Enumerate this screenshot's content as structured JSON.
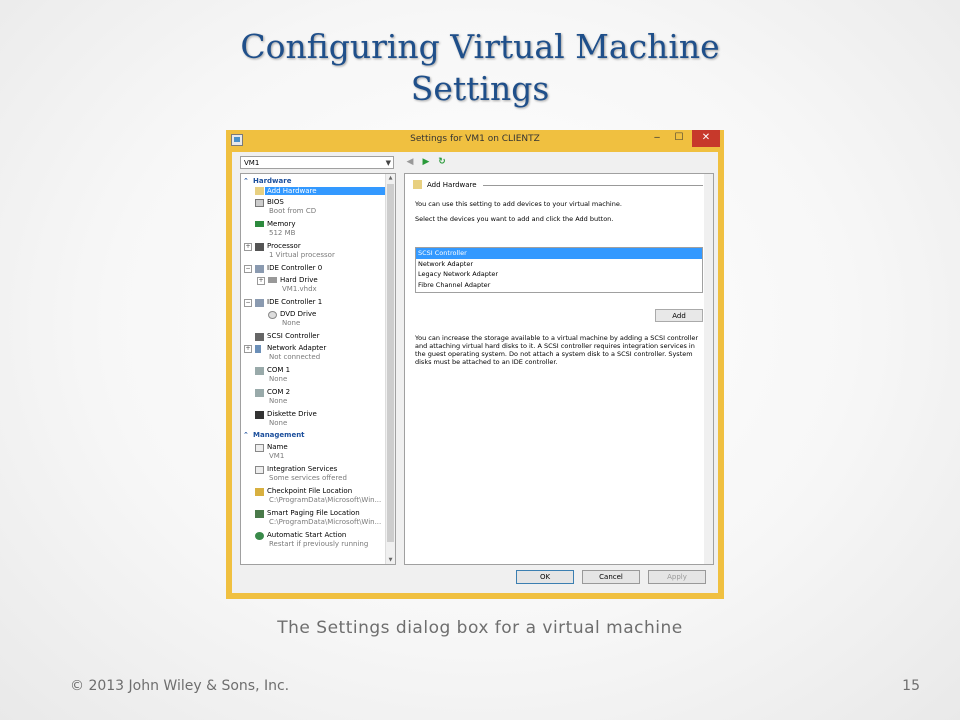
{
  "slide": {
    "title_line1": "Configuring Virtual Machine",
    "title_line2": "Settings",
    "caption": "The Settings dialog box for a virtual machine",
    "copyright": "© 2013 John Wiley & Sons, Inc.",
    "page_number": "15"
  },
  "dialog": {
    "title": "Settings for VM1 on CLIENTZ",
    "vm_selector": "VM1",
    "tree": {
      "hardware_label": "Hardware",
      "management_label": "Management",
      "hardware_items": [
        {
          "label": "Add Hardware",
          "sub": ""
        },
        {
          "label": "BIOS",
          "sub": "Boot from CD"
        },
        {
          "label": "Memory",
          "sub": "512 MB"
        },
        {
          "label": "Processor",
          "sub": "1 Virtual processor"
        },
        {
          "label": "IDE Controller 0",
          "sub": ""
        },
        {
          "label": "Hard Drive",
          "sub": "VM1.vhdx"
        },
        {
          "label": "IDE Controller 1",
          "sub": ""
        },
        {
          "label": "DVD Drive",
          "sub": "None"
        },
        {
          "label": "SCSI Controller",
          "sub": ""
        },
        {
          "label": "Network Adapter",
          "sub": "Not connected"
        },
        {
          "label": "COM 1",
          "sub": "None"
        },
        {
          "label": "COM 2",
          "sub": "None"
        },
        {
          "label": "Diskette Drive",
          "sub": "None"
        }
      ],
      "management_items": [
        {
          "label": "Name",
          "sub": "VM1"
        },
        {
          "label": "Integration Services",
          "sub": "Some services offered"
        },
        {
          "label": "Checkpoint File Location",
          "sub": "C:\\ProgramData\\Microsoft\\Win..."
        },
        {
          "label": "Smart Paging File Location",
          "sub": "C:\\ProgramData\\Microsoft\\Win..."
        },
        {
          "label": "Automatic Start Action",
          "sub": "Restart if previously running"
        }
      ]
    },
    "detail": {
      "heading": "Add Hardware",
      "intro": "You can use this setting to add devices to your virtual machine.",
      "instruction": "Select the devices you want to add and click the Add button.",
      "devices": [
        "SCSI Controller",
        "Network Adapter",
        "Legacy Network Adapter",
        "Fibre Channel Adapter"
      ],
      "add_label": "Add",
      "info": "You can increase the storage available to a virtual machine by adding a SCSI controller and attaching virtual hard disks to it. A SCSI controller requires integration services in the guest operating system. Do not attach a system disk to a SCSI controller. System disks must be attached to an IDE controller."
    },
    "buttons": {
      "ok": "OK",
      "cancel": "Cancel",
      "apply": "Apply"
    },
    "colors": {
      "frame": "#f0c040",
      "selection": "#3399ff",
      "section": "#1c4f9c"
    }
  }
}
